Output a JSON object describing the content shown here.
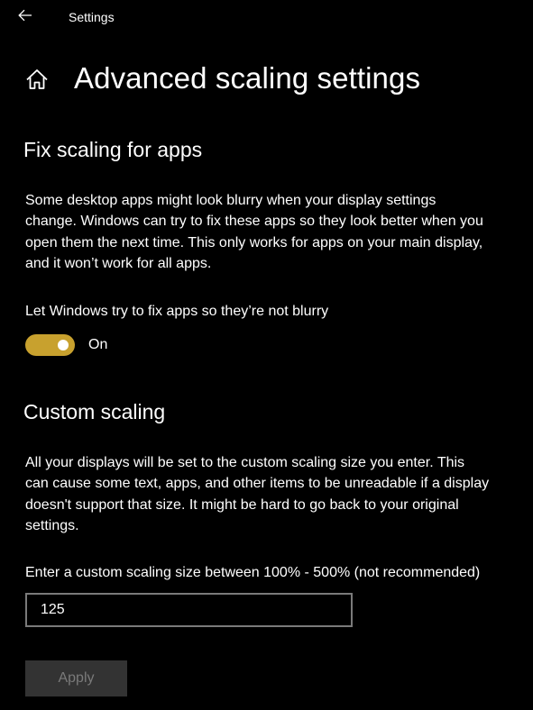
{
  "window": {
    "title": "Settings",
    "back_icon": "back-arrow-icon"
  },
  "header": {
    "home_icon": "home-icon",
    "title": "Advanced scaling settings"
  },
  "fix_scaling": {
    "heading": "Fix scaling for apps",
    "description_lines": [
      "Some desktop apps might look blurry when your display settings",
      "change. Windows can try to fix these apps so they look better when you",
      "open them the next time. This only works for apps on your main display,",
      "and it won’t work for all apps."
    ],
    "toggle_label": "Let Windows try to fix apps so they’re not blurry",
    "toggle_state": "On",
    "toggle_on": true,
    "accent_color": "#c8a12e"
  },
  "custom_scaling": {
    "heading": "Custom scaling",
    "description_lines": [
      "All your displays will be set to the custom scaling size you enter. This",
      "can cause some text, apps, and other items to be unreadable if a display",
      "doesn't support that size. It might be hard to go back to your original",
      "settings."
    ],
    "input_label": "Enter a custom scaling size between 100% - 500% (not recommended)",
    "input_value": "125",
    "apply_label": "Apply",
    "apply_enabled": false
  }
}
